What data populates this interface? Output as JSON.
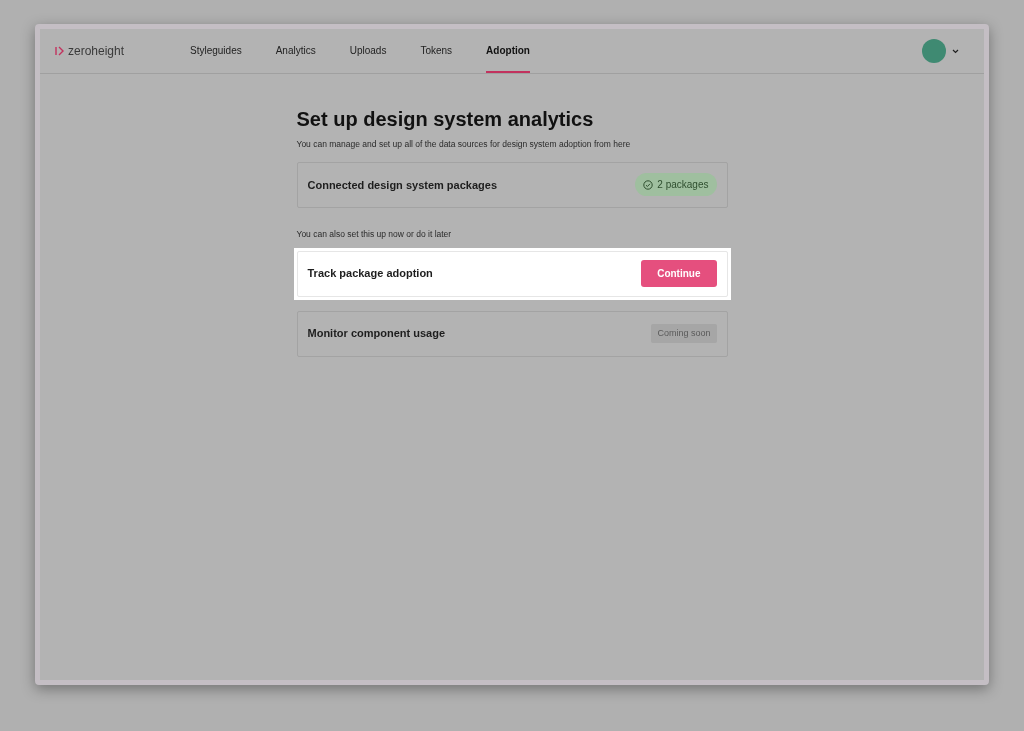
{
  "brand": {
    "name": "zeroheight"
  },
  "nav": [
    {
      "label": "Styleguides",
      "selected": false
    },
    {
      "label": "Analytics",
      "selected": false
    },
    {
      "label": "Uploads",
      "selected": false
    },
    {
      "label": "Tokens",
      "selected": false
    },
    {
      "label": "Adoption",
      "selected": true
    }
  ],
  "page": {
    "title": "Set up design system analytics",
    "subtitle": "You can manage and set up all of the data sources for design system adoption from here",
    "section_note": "You can also set this up now or do it later"
  },
  "cards": [
    {
      "title": "Connected design system packages",
      "kind": "status",
      "action": "2 packages",
      "highlighted": false
    },
    {
      "title": "Track package adoption",
      "kind": "button",
      "action": "Continue",
      "highlighted": true
    },
    {
      "title": "Monitor component usage",
      "kind": "tag",
      "action": "Coming soon",
      "highlighted": false
    }
  ]
}
